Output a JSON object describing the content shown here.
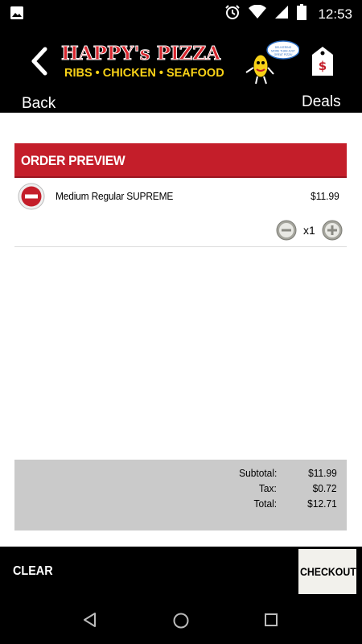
{
  "status_bar": {
    "time": "12:53",
    "icons": [
      "image-icon",
      "alarm-icon",
      "wifi-icon",
      "signal-icon",
      "battery-icon"
    ]
  },
  "header": {
    "back_label": "Back",
    "deals_label": "Deals",
    "deals_tag_symbol": "$",
    "logo": {
      "line1": "HAPPY's PIZZA",
      "line2": "RIBS • CHICKEN • SEAFOOD",
      "bubble_text": "DELIVERING MORE THAN JUST GREAT PIZZA!"
    }
  },
  "order_preview": {
    "title": "ORDER PREVIEW",
    "items": [
      {
        "name": "Medium Regular SUPREME",
        "price": "$11.99",
        "quantity": "x1"
      }
    ]
  },
  "totals": {
    "subtotal_label": "Subtotal:",
    "subtotal_value": "$11.99",
    "tax_label": "Tax:",
    "tax_value": "$0.72",
    "total_label": "Total:",
    "total_value": "$12.71"
  },
  "actions": {
    "clear_label": "CLEAR",
    "checkout_label": "CHECKOUT"
  },
  "colors": {
    "accent_red": "#c41e2a",
    "logo_yellow": "#f7d117",
    "totals_bg": "#cacaca",
    "checkout_bg": "#f2f1ec"
  }
}
